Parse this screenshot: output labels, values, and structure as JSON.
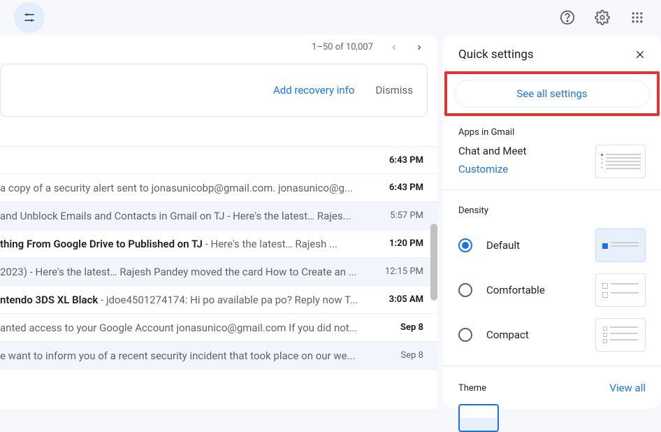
{
  "header": {},
  "toolbar": {
    "pagination": "1–50 of 10,007"
  },
  "banner": {
    "recovery": "Add recovery info",
    "dismiss": "Dismiss"
  },
  "emails": [
    {
      "subject": "",
      "preview": "",
      "time": "6:43 PM",
      "unread": true
    },
    {
      "subject": "",
      "preview": "a copy of a security alert sent to jonasunicobp@gmail.com. jonasunico@g...",
      "time": "6:43 PM",
      "unread": true
    },
    {
      "subject": " and Unblock Emails and Contacts in Gmail on TJ",
      "preview": " - Here's the latest… Rajes...",
      "time": "5:57 PM",
      "unread": false
    },
    {
      "subject": "thing From Google Drive to Published on TJ",
      "preview": " - Here's the latest… Rajesh ...",
      "time": "1:20 PM",
      "unread": true
    },
    {
      "subject": "2023)",
      "preview": " - Here's the latest… Rajesh Pandey moved the card How to Create an ...",
      "time": "12:15 PM",
      "unread": false
    },
    {
      "subject": "ntendo 3DS XL Black",
      "preview": " - jdoe4501274174: Hi po available pa po? Reply now T...",
      "time": "3:05 AM",
      "unread": true
    },
    {
      "subject": "",
      "preview": "anted access to your Google Account jonasunico@gmail.com If you did not...",
      "time": "Sep 8",
      "unread": true
    },
    {
      "subject": "",
      "preview": "e want to inform you of a recent security incident that took place on our we...",
      "time": "Sep 8",
      "unread": false
    }
  ],
  "panel": {
    "title": "Quick settings",
    "see_all": "See all settings",
    "apps_title": "Apps in Gmail",
    "chat_meet": "Chat and Meet",
    "customize": "Customize",
    "density_title": "Density",
    "density": [
      {
        "label": "Default",
        "checked": true
      },
      {
        "label": "Comfortable",
        "checked": false
      },
      {
        "label": "Compact",
        "checked": false
      }
    ],
    "theme_title": "Theme",
    "view_all": "View all"
  }
}
